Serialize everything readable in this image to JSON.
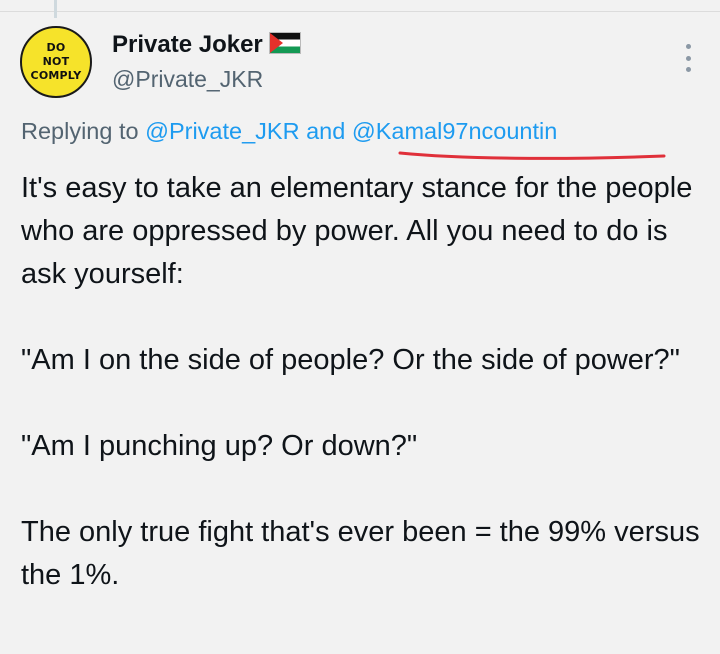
{
  "author": {
    "avatar_text": [
      "DO",
      "NOT",
      "COMPLY"
    ],
    "display_name": "Private Joker",
    "flag_emoji": "🇵🇸",
    "handle": "@Private_JKR"
  },
  "reply_context": {
    "prefix": "Replying to",
    "mention_1": "@Private_JKR",
    "joiner": "and",
    "mention_2": "@Kamal97ncountin"
  },
  "tweet": {
    "paragraphs": [
      "It's easy to take an elementary stance for the people who are oppressed by power. All you need to do is ask yourself:",
      "\"Am I on the side of people? Or the side of power?\"",
      "\"Am I punching up? Or down?\"",
      "The only true fight that's ever been = the 99% versus the 1%."
    ]
  },
  "icons": {
    "more": "more-vertical-icon",
    "flag": "palestine-flag-icon"
  },
  "colors": {
    "background": "#f2f2f2",
    "text": "#0f1419",
    "secondary_text": "#536471",
    "mention": "#1d9bf0",
    "avatar_yellow": "#f6e32a",
    "annotation_red": "#e0303a"
  }
}
